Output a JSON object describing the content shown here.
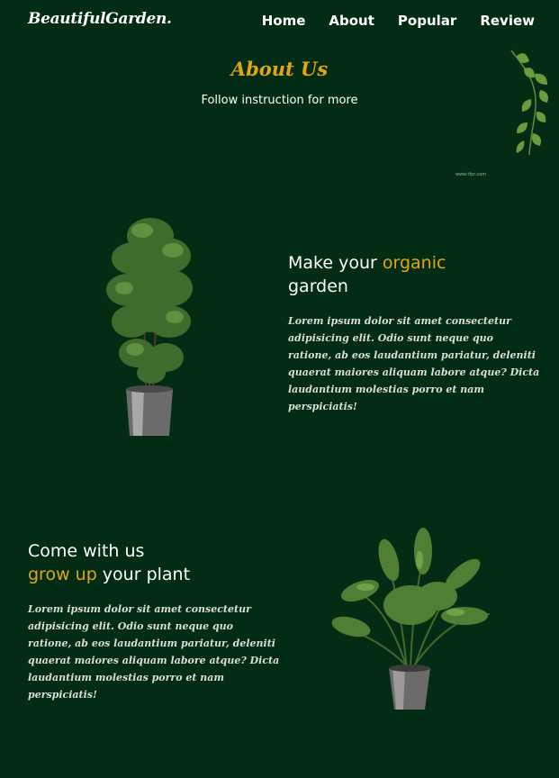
{
  "nav": {
    "logo": "BeautifulGarden.",
    "links": [
      "Home",
      "About",
      "Popular",
      "Review"
    ]
  },
  "hero": {
    "title": "About Us",
    "subtitle": "Follow instruction for more"
  },
  "watermark": "www.tfpr.com",
  "section1": {
    "heading_a": "Make your ",
    "heading_accent": "organic",
    "heading_b": "garden",
    "text": "Lorem ipsum dolor sit amet consectetur adipisicing elit. Odio sunt neque quo ratione, ab eos laudantium pariatur, deleniti quaerat maiores aliquam labore atque? Dicta laudantium molestias porro et nam perspiciatis!"
  },
  "section2": {
    "heading_a": "Come with us",
    "heading_accent": "grow up",
    "heading_b": " your plant",
    "text": "Lorem ipsum dolor sit amet consectetur adipisicing elit. Odio sunt neque quo ratione, ab eos laudantium pariatur, deleniti quaerat maiores aliquam labore atque? Dicta laudantium molestias porro et nam perspiciatis!"
  },
  "colors": {
    "background": "#032c14",
    "accent": "#e2a613",
    "text": "#ffffff"
  }
}
